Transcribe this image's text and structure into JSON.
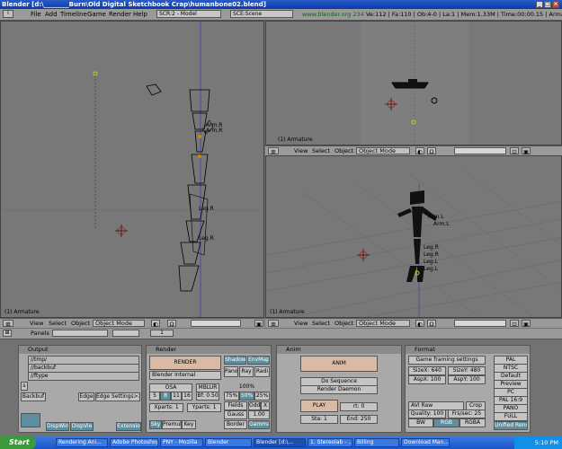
{
  "window": {
    "title": "Blender [d:\\________Burn\\Old Digital Sketchbook Crap\\humanbone02.blend]"
  },
  "menubar": {
    "items": [
      "File",
      "Add",
      "Timeline",
      "Game",
      "Render",
      "Help"
    ],
    "screen_field": "SCR:2 - Model",
    "scene_field": "SCE:Scene",
    "website": "www.blender.org 234",
    "stats": "Ve:112 | Fa:110 | Ob:4-0 | La:1 | Mem:1.33M | Time:00:00.15 | Armature"
  },
  "viewports": {
    "left_label": "(1) Armature",
    "top_right_label": "(1) Armature",
    "bottom_right_label": "(1) Armature",
    "bones_left": [
      "Arm.R",
      "Arm.R",
      "Leg.R",
      "Leg.R"
    ],
    "bones_right": [
      "Arm.L",
      "Arm.L",
      "Leg.R",
      "Leg.R",
      "Leg.L",
      "Leg.L"
    ]
  },
  "header3d": {
    "view": "View",
    "select": "Select",
    "object": "Object",
    "mode": "Object Mode"
  },
  "buttons_header": {
    "panels_label": "Panels",
    "frame_value": "1"
  },
  "output_panel": {
    "title": "Output",
    "path1": "//tmp/",
    "path2": "//backbuf",
    "path3": "//ftype",
    "backbuf": "Backbuf",
    "edge": "Edge",
    "edge_settings": "Edge Settings>>",
    "dispwin": "DispWin",
    "dispview": "DispVie",
    "extensions": "Extensio"
  },
  "render_panel": {
    "title": "Render",
    "render_btn": "RENDER",
    "engine": "Blender Internal",
    "shadow": "Shadow",
    "envmap": "EnvMap",
    "pano": "Pano",
    "ray": "Ray",
    "radio": "Radi",
    "osa": "OSA",
    "osa_values": [
      "5",
      "8",
      "11",
      "16"
    ],
    "mblur": "MBLUR",
    "bf": "Bf: 0.50",
    "percent": "100%",
    "percent_values": [
      "75%",
      "50%",
      "25%"
    ],
    "xparts": "Xparts: 1",
    "yparts": "Yparts: 1",
    "fields": "Fields",
    "odd": "Odd",
    "x": "X",
    "gauss": "Gauss",
    "gauss_val": "1.00",
    "sky": "Sky",
    "premul": "Premul",
    "key": "Key",
    "border": "Border",
    "gamma": "Gamma"
  },
  "anim_panel": {
    "title": "Anim",
    "anim_btn": "ANIM",
    "do_sequence": "Do Sequence",
    "render_daemon": "Render Daemon",
    "play": "PLAY",
    "rt": "rt: 0",
    "sta": "Sta: 1",
    "end": "End: 250"
  },
  "format_panel": {
    "title": "Format",
    "game_framing": "Game framing settings",
    "sizex": "SizeX: 640",
    "sizey": "SizeY: 480",
    "aspx": "AspX: 100",
    "aspy": "AspY: 100",
    "codec": "AVI Raw",
    "crop": "Crop",
    "quality": "Quality: 100",
    "frs": "Frs/sec: 25",
    "bw": "BW",
    "rgb": "RGB",
    "rgba": "RGBA",
    "presets": [
      "PAL",
      "NTSC",
      "Default",
      "Preview",
      "PC",
      "PAL 16:9",
      "PANO",
      "FULL",
      "Unified Rend"
    ]
  },
  "taskbar": {
    "start": "Start",
    "tasks": [
      "Rendering Ani...",
      "Adobe Photoshop",
      "PNY - Mozilla",
      "Blender",
      "Blender [d:\\...",
      "1. Stereolab - ...",
      "Billing",
      "Download Man..."
    ],
    "clock": "5:10 PM"
  }
}
